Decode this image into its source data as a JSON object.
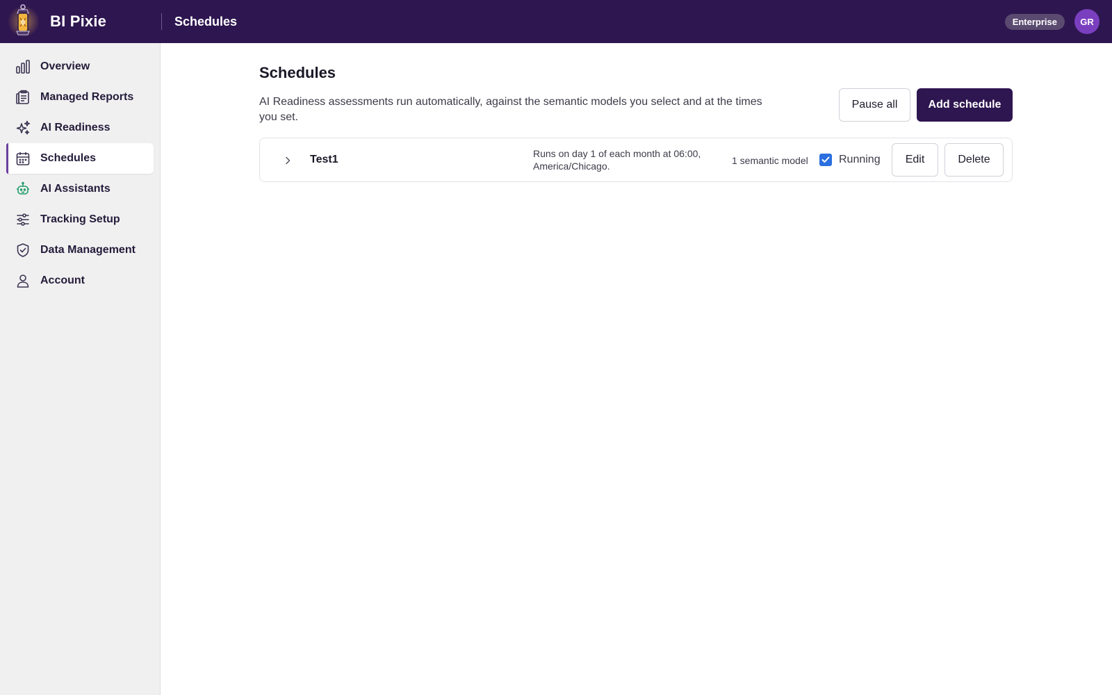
{
  "app": {
    "name": "BI Pixie",
    "current_page": "Schedules"
  },
  "header": {
    "plan_badge": "Enterprise",
    "avatar_initials": "GR"
  },
  "colors": {
    "header_bg": "#2e1650",
    "primary": "#2e1650",
    "accent": "#6b3fa0",
    "checkbox": "#2b6fe0",
    "avatar": "#7a3fbf"
  },
  "sidebar": {
    "items": [
      {
        "label": "Overview",
        "icon": "bar-chart-icon"
      },
      {
        "label": "Managed Reports",
        "icon": "clipboard-icon"
      },
      {
        "label": "AI Readiness",
        "icon": "sparkles-icon"
      },
      {
        "label": "Schedules",
        "icon": "calendar-icon",
        "active": true
      },
      {
        "label": "AI Assistants",
        "icon": "robot-icon"
      },
      {
        "label": "Tracking Setup",
        "icon": "sliders-icon"
      },
      {
        "label": "Data Management",
        "icon": "shield-check-icon"
      },
      {
        "label": "Account",
        "icon": "user-icon"
      }
    ]
  },
  "main": {
    "title": "Schedules",
    "description": "AI Readiness assessments run automatically, against the semantic models you select and at the times you set.",
    "pause_all_label": "Pause all",
    "add_schedule_label": "Add schedule",
    "schedules": [
      {
        "name": "Test1",
        "description": "Runs on day 1 of each month at 06:00, America/Chicago.",
        "models": "1 semantic model",
        "status_label": "Running",
        "running": true,
        "edit_label": "Edit",
        "delete_label": "Delete"
      }
    ]
  }
}
